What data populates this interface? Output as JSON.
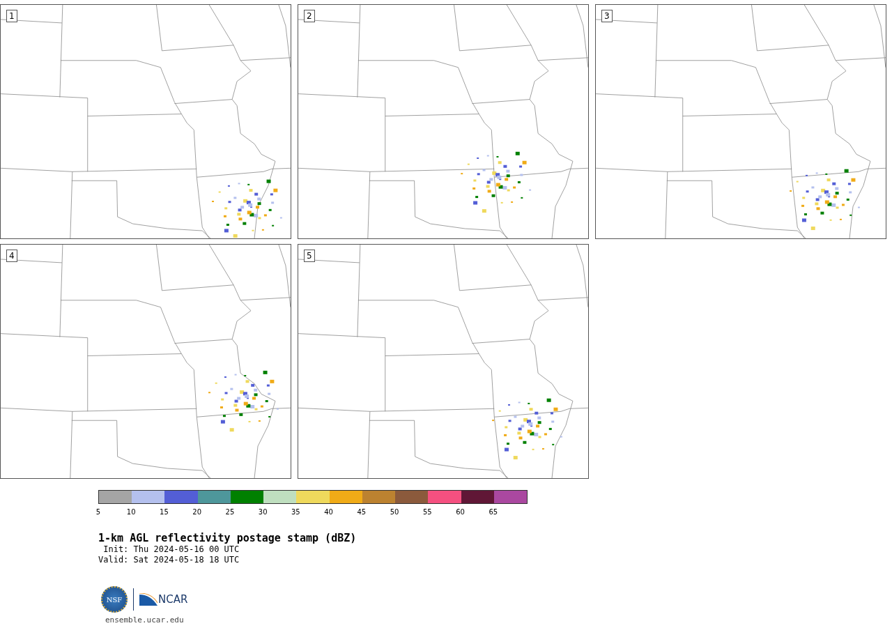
{
  "panels": [
    {
      "label": "1"
    },
    {
      "label": "2"
    },
    {
      "label": "3"
    },
    {
      "label": "4"
    },
    {
      "label": "5"
    }
  ],
  "colorbar": {
    "bins": [
      {
        "color": "#a5a5a5"
      },
      {
        "color": "#b4c0ee"
      },
      {
        "color": "#535ed6"
      },
      {
        "color": "#4e979b"
      },
      {
        "color": "#008000"
      },
      {
        "color": "#bfdfbf"
      },
      {
        "color": "#efd95c"
      },
      {
        "color": "#f0ab17"
      },
      {
        "color": "#bc8230"
      },
      {
        "color": "#8b5a3c"
      },
      {
        "color": "#f55080"
      },
      {
        "color": "#601736"
      },
      {
        "color": "#aa48a0"
      }
    ],
    "ticks": [
      "5",
      "10",
      "15",
      "20",
      "25",
      "30",
      "35",
      "40",
      "45",
      "50",
      "55",
      "60",
      "65"
    ]
  },
  "title": "1-km AGL reflectivity postage stamp (dBZ)",
  "init": " Init: Thu 2024-05-16 00 UTC",
  "valid": "Valid: Sat 2024-05-18 18 UTC",
  "logos": {
    "nsf": "NSF",
    "ncar": "NCAR"
  },
  "url": "ensemble.ucar.edu"
}
